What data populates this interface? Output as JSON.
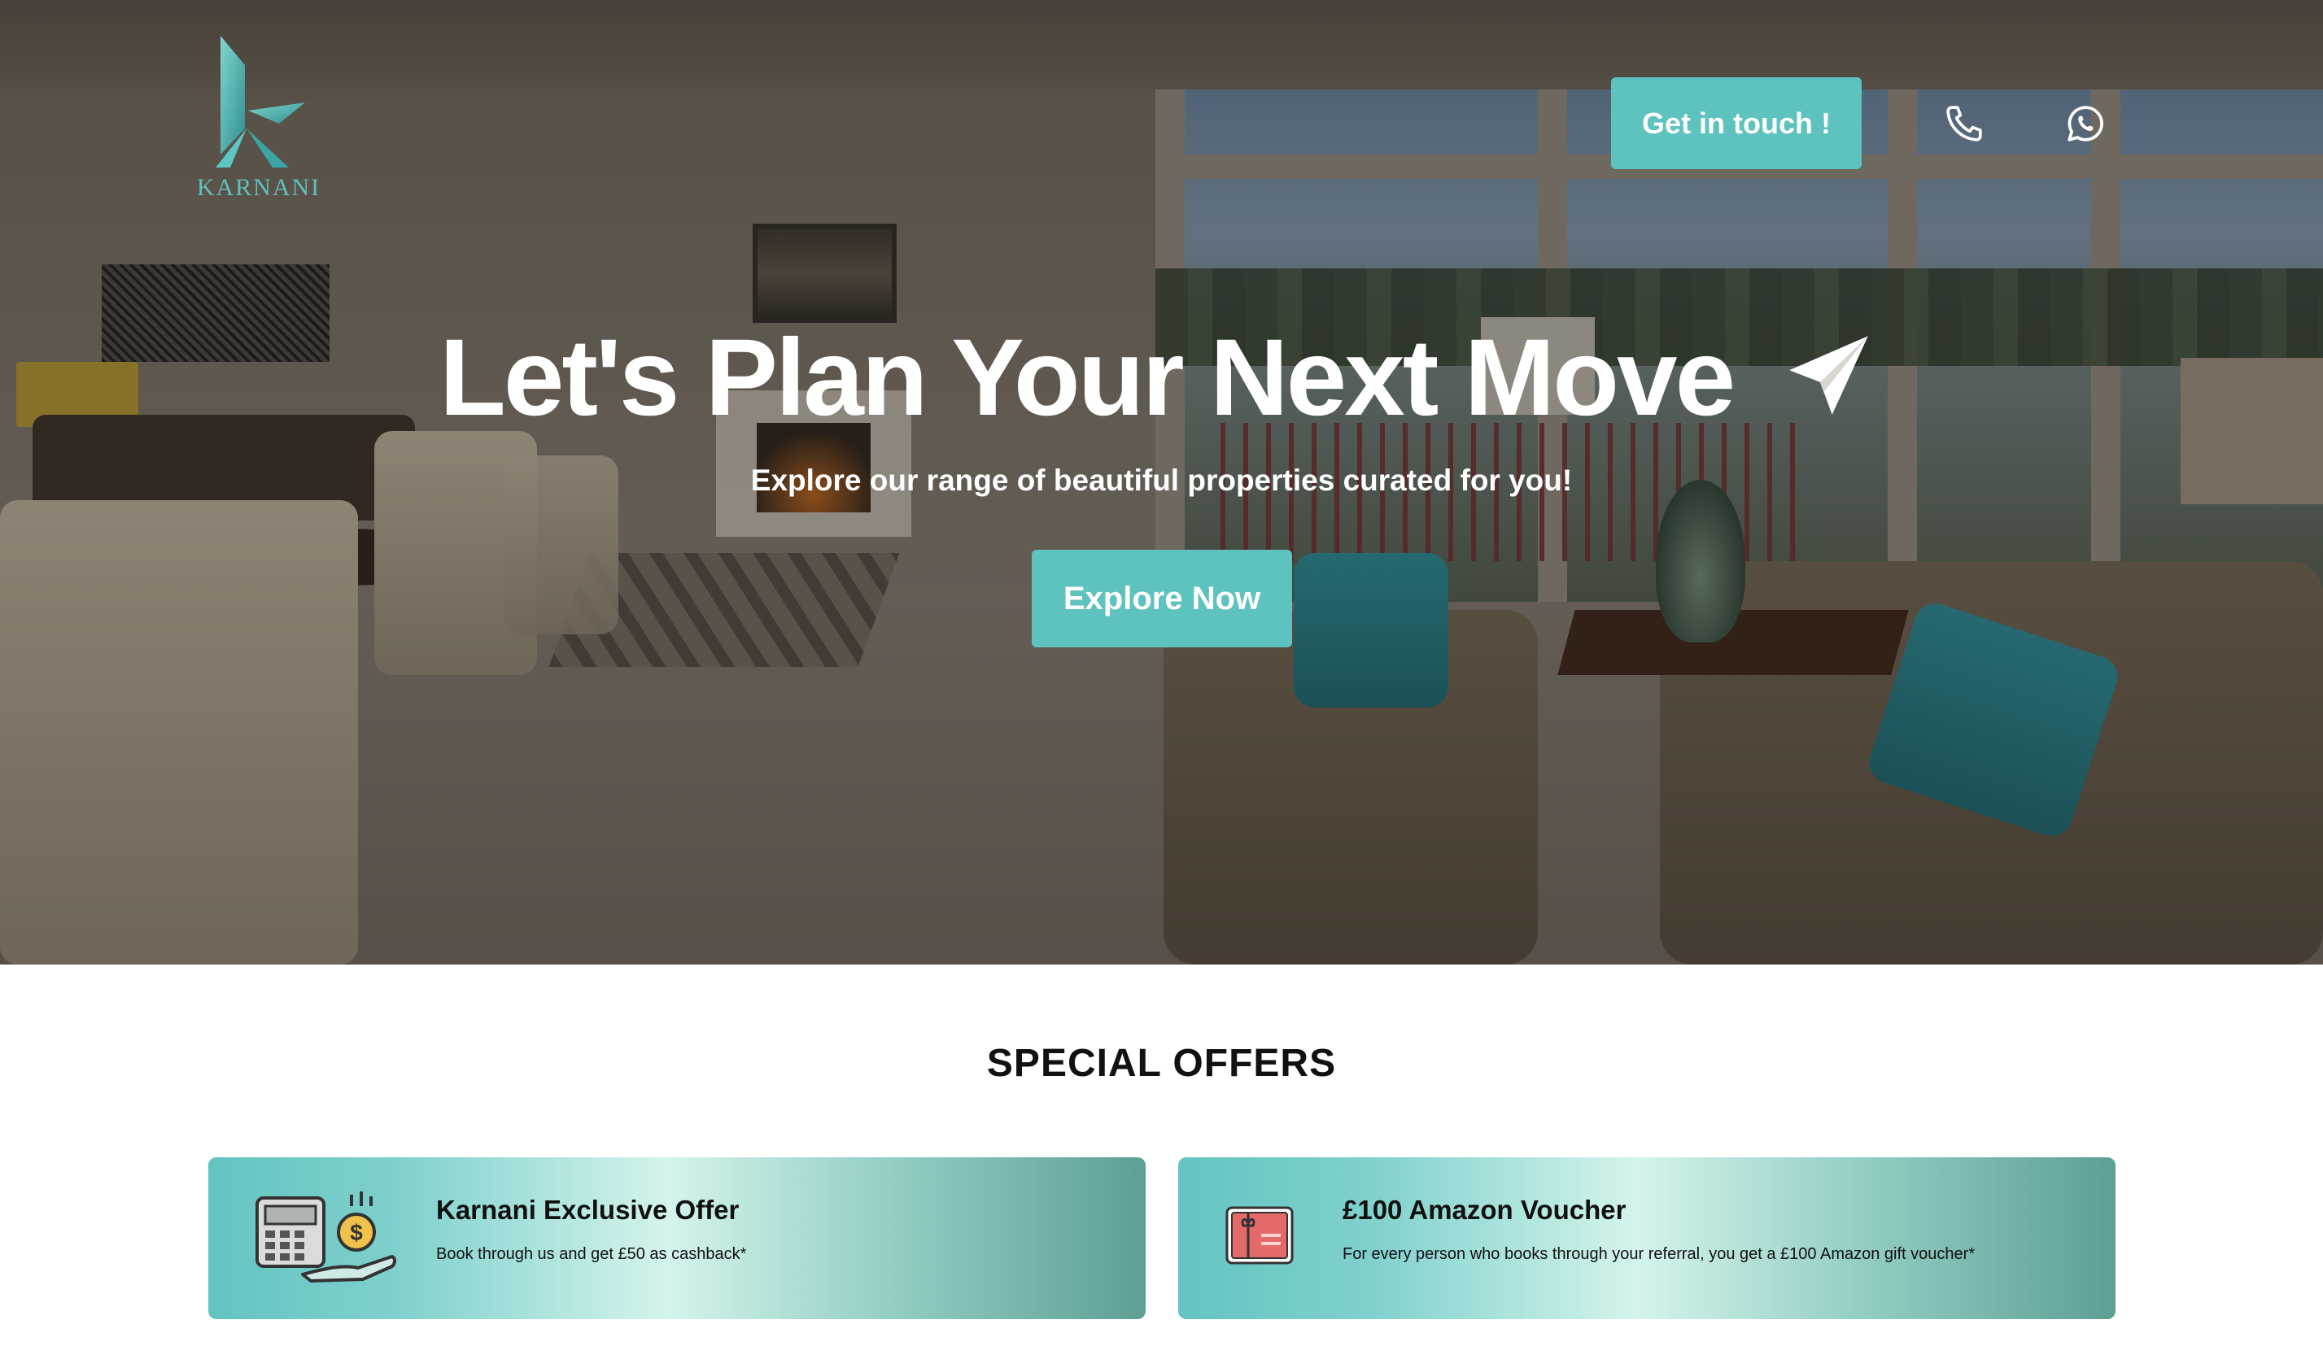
{
  "brand": {
    "name": "KARNANI",
    "accent": "#5ec2bf"
  },
  "header": {
    "cta_label": "Get in touch !",
    "icons": [
      "phone-icon",
      "whatsapp-icon"
    ]
  },
  "hero": {
    "title": "Let's Plan Your Next Move",
    "title_icon": "paper-plane-icon",
    "subtitle": "Explore our range of beautiful properties curated for you!",
    "cta_label": "Explore Now"
  },
  "offers": {
    "heading": "SPECIAL OFFERS",
    "items": [
      {
        "icon": "cashback-calculator-icon",
        "title": "Karnani Exclusive Offer",
        "description": "Book through us and get £50 as cashback*"
      },
      {
        "icon": "gift-card-icon",
        "title": "£100 Amazon Voucher",
        "description": "For every person who books through your referral, you get a £100 Amazon gift voucher*"
      }
    ]
  }
}
